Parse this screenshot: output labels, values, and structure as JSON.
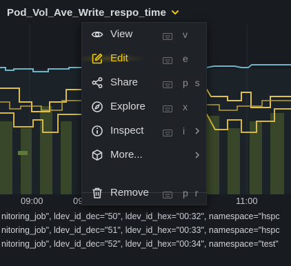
{
  "panel": {
    "title": "Pod_Vol_Ave_Write_respo_time"
  },
  "x_axis": {
    "ticks": [
      "09:00",
      "09",
      "11:00"
    ]
  },
  "legend": {
    "rows": [
      "nitoring_job\", ldev_id_dec=\"50\", ldev_id_hex=\"00:32\", namespace=\"hspc",
      "nitoring_job\", ldev_id_dec=\"51\", ldev_id_hex=\"00:33\", namespace=\"hspc",
      "nitoring_job\", ldev_id_dec=\"52\", ldev_id_hex=\"00:34\", namespace=\"test\""
    ]
  },
  "menu": {
    "items": [
      {
        "label": "View",
        "icon": "eye-icon",
        "shortcut": "v"
      },
      {
        "label": "Edit",
        "icon": "edit-icon",
        "shortcut": "e"
      },
      {
        "label": "Share",
        "icon": "share-icon",
        "shortcut": "p s"
      },
      {
        "label": "Explore",
        "icon": "compass-icon",
        "shortcut": "x"
      },
      {
        "label": "Inspect",
        "icon": "info-icon",
        "shortcut": "i"
      },
      {
        "label": "More...",
        "icon": "cube-icon",
        "shortcut": ""
      },
      {
        "label": "Remove",
        "icon": "trash-icon",
        "shortcut": "p r"
      }
    ]
  },
  "colors": {
    "accent": "#f2cc0c",
    "series_cyan": "#6fb5c7",
    "series_yellow": "#e0c24a",
    "series_green": "#7ea561"
  }
}
